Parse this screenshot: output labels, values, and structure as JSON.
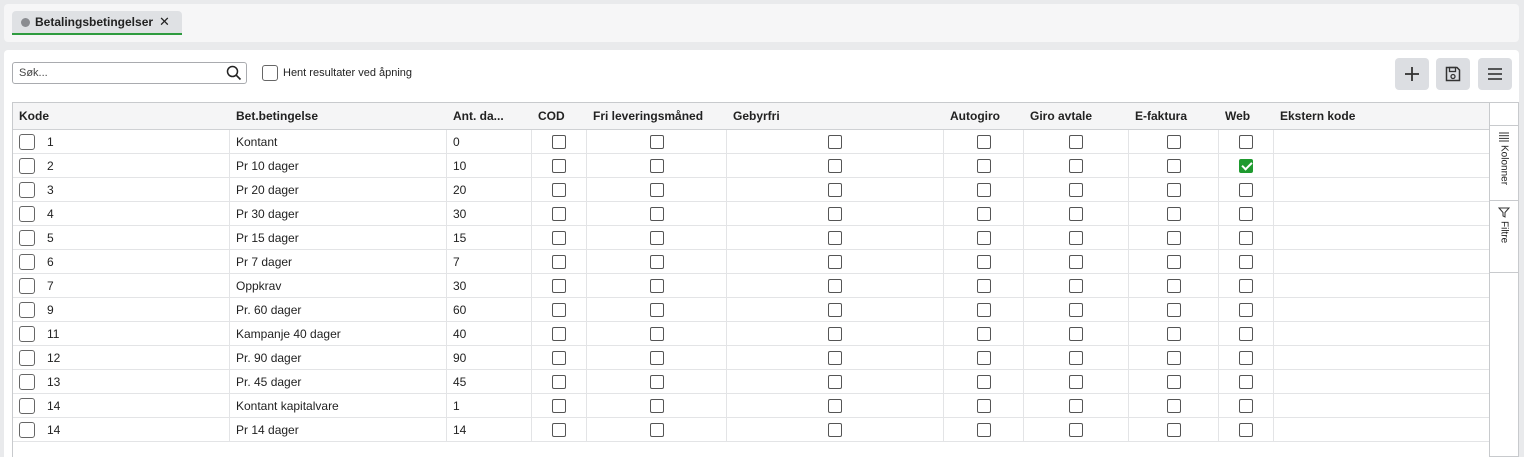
{
  "tabs": [
    {
      "label": "Betalingsbetingelser",
      "close": "✕"
    }
  ],
  "toolbar": {
    "search_placeholder": "Søk...",
    "fetch_label": "Hent resultater ved åpning"
  },
  "side_panel": {
    "columns_label": "Kolonner",
    "filters_label": "Filtre"
  },
  "grid": {
    "columns": [
      "Kode",
      "Bet.betingelse",
      "Ant. da...",
      "COD",
      "Fri leveringsmåned",
      "Gebyrfri",
      "Autogiro",
      "Giro avtale",
      "E-faktura",
      "Web",
      "Ekstern kode"
    ],
    "rows": [
      {
        "kode": "1",
        "bet": "Kontant",
        "ant": "0",
        "web": false
      },
      {
        "kode": "2",
        "bet": "Pr 10 dager",
        "ant": "10",
        "web": true
      },
      {
        "kode": "3",
        "bet": "Pr 20 dager",
        "ant": "20",
        "web": false
      },
      {
        "kode": "4",
        "bet": "Pr 30 dager",
        "ant": "30",
        "web": false
      },
      {
        "kode": "5",
        "bet": "Pr 15 dager",
        "ant": "15",
        "web": false
      },
      {
        "kode": "6",
        "bet": "Pr 7 dager",
        "ant": "7",
        "web": false
      },
      {
        "kode": "7",
        "bet": "Oppkrav",
        "ant": "30",
        "web": false
      },
      {
        "kode": "9",
        "bet": "Pr. 60 dager",
        "ant": "60",
        "web": false
      },
      {
        "kode": "11",
        "bet": "Kampanje 40 dager",
        "ant": "40",
        "web": false
      },
      {
        "kode": "12",
        "bet": "Pr. 90 dager",
        "ant": "90",
        "web": false
      },
      {
        "kode": "13",
        "bet": "Pr. 45 dager",
        "ant": "45",
        "web": false
      },
      {
        "kode": "14",
        "bet": "Kontant kapitalvare",
        "ant": "1",
        "web": false
      },
      {
        "kode": "14",
        "bet": "Pr 14 dager",
        "ant": "14",
        "web": false
      }
    ]
  },
  "colors": {
    "accent": "#2e9b3f",
    "checked": "#1f9a2f"
  }
}
